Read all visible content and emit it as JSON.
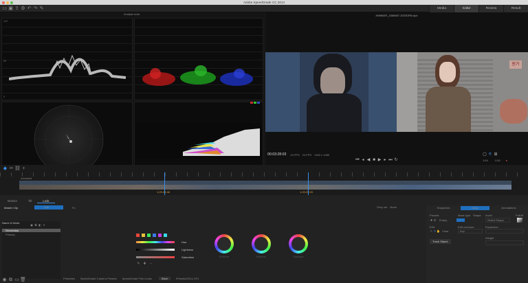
{
  "app": {
    "title": "Adobe SpeedGrade CC 2014",
    "workspace_tabs": [
      {
        "label": "Media",
        "active": false
      },
      {
        "label": "Color",
        "active": true
      },
      {
        "label": "Review",
        "active": false
      },
      {
        "label": "Result",
        "active": false
      }
    ]
  },
  "scopes": {
    "header": "Analysis tools",
    "clamp_label": "Clamp Signal",
    "layout_label": "4 Scope Layout",
    "resolution": "100%",
    "luma_ticks": [
      "100",
      "90",
      "80",
      "70",
      "60",
      "50",
      "40",
      "30",
      "20",
      "10",
      "0"
    ]
  },
  "viewer": {
    "filename": "#NNNDR_1566687-2022DRN.dpx",
    "timecode": "00:03:28:03",
    "fps": "24 FPS",
    "speed": "24 FPS",
    "resolution": "1940 x 1080",
    "zoom_left": "1/16",
    "zoom_right": "1/16",
    "sign_text": "원가"
  },
  "timeline": {
    "track_label": "unlocked",
    "clip_label_1": "1:29:28:46",
    "clip_label_2": "1:29:29:03"
  },
  "lower": {
    "tabs": [
      {
        "label": "Monitor",
        "active": false
      },
      {
        "label": "Tilt",
        "active": false
      },
      {
        "label": "Look",
        "active": true
      }
    ],
    "master_clip": "Master Clip",
    "clip": "Clip",
    "fx_label": "Fx",
    "layer_section": "Name & Mode",
    "layers": [
      {
        "name": "Secondary",
        "selected": true
      },
      {
        "name": "Primary",
        "selected": false
      }
    ],
    "color_swatches": [
      "#e8473b",
      "#e8c23b",
      "#3be85a",
      "#3b7be8",
      "#c83be8",
      "#3bd8e8"
    ],
    "slider_labels": [
      "Hue",
      "Lightness",
      "Saturation"
    ],
    "wheel_labels": [
      "Shadows",
      "Midtones",
      "Highlights"
    ],
    "status_links": [
      "Primaries",
      "SpeedGrade Camera Presets",
      "SpeedGrade Film Looks"
    ],
    "save_button": "Save",
    "look_file": "/Presets/2014.1/Fx"
  },
  "right_panel": {
    "tabs": [
      {
        "label": "Snapshots",
        "active": false
      },
      {
        "label": "Mask",
        "active": true
      },
      {
        "label": "Annotations",
        "active": false
      }
    ],
    "grey_out": "Grey out",
    "grey_out_value": "None",
    "presets_label": "Presets",
    "mask_type_label": "Mask type",
    "shape_label": "Shape",
    "invert_label": "Invert",
    "falloff_label": "Falloff",
    "select_shape": "Select Shape",
    "edit_label": "Edit",
    "edit_contours_label": "Edit contours",
    "expansion_label": "Expansion",
    "preset_value": "Empty",
    "contour_value": "Any",
    "clear_label": "Clear",
    "track_object_button": "Track Object",
    "weight_label": "Weight"
  }
}
